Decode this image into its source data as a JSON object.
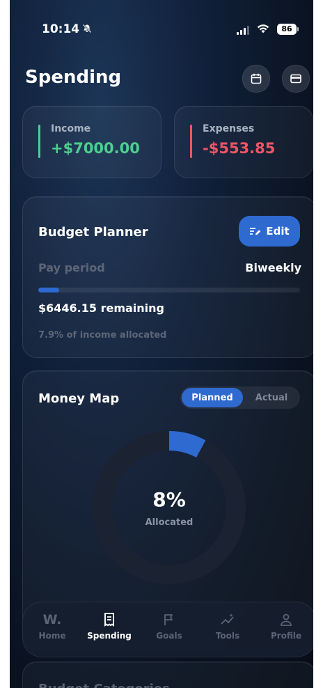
{
  "status_bar": {
    "time": "10:14",
    "battery": "86"
  },
  "header": {
    "title": "Spending"
  },
  "summary": {
    "income": {
      "label": "Income",
      "value": "+$7000.00",
      "color": "#4ccf8f"
    },
    "expenses": {
      "label": "Expenses",
      "value": "-$553.85",
      "color": "#ef5566"
    }
  },
  "budget_planner": {
    "title": "Budget Planner",
    "edit_label": "Edit",
    "pay_period_label": "Pay period",
    "pay_period_value": "Biweekly",
    "progress_fraction": 0.079,
    "remaining": "$6446.15 remaining",
    "allocated_note": "7.9% of income allocated"
  },
  "money_map": {
    "title": "Money Map",
    "toggle": {
      "planned": "Planned",
      "actual": "Actual",
      "selected": "Planned"
    },
    "percent": "8%",
    "percent_label": "Allocated",
    "allocated_fraction": 0.079
  },
  "next_section_title": "Budget Categories",
  "tab_bar": {
    "items": [
      {
        "label": "Home",
        "icon": "w-logo-icon"
      },
      {
        "label": "Spending",
        "icon": "receipt-icon",
        "active": true
      },
      {
        "label": "Goals",
        "icon": "flag-icon"
      },
      {
        "label": "Tools",
        "icon": "sparkle-chart-icon"
      },
      {
        "label": "Profile",
        "icon": "person-icon"
      }
    ]
  },
  "colors": {
    "accent": "#2f6ad0",
    "income": "#4ccf8f",
    "expense": "#ef5566"
  }
}
